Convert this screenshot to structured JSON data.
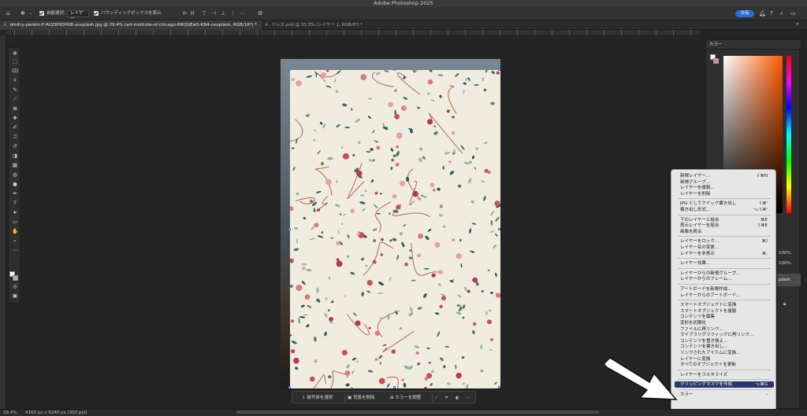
{
  "app": {
    "title": "Adobe Photoshop 2025"
  },
  "options": {
    "auto_select_label": "自動選択：",
    "layer_select": "レイヤー",
    "bounding_box_label": "バウンディングボックスを表示",
    "share": "共有"
  },
  "tabs": [
    {
      "label": "dmitry-pankin-F-AUZKHOH08-unsplash.jpg @ 29.4% (art-institute-of-chicago-6NQGEw5-KN4-unsplash, RGB/16*) *",
      "close": "×"
    },
    {
      "label": "ドレス.psd @ 33.3% (レイヤー 1, RGB/8*) *",
      "close": "×"
    }
  ],
  "status": {
    "zoom": "29.4%",
    "doc_info": "4160 px x 6240 px (300 ppi)"
  },
  "context_bar": {
    "select_subject": "被写体を選択",
    "remove_bg": "背景を削除",
    "adjust_color": "カラーを調整"
  },
  "panel": {
    "color_title": "カラー",
    "opacity": "100%",
    "fill": "100%",
    "layer_name": "plash"
  },
  "menu": {
    "items": [
      {
        "label": "新規レイヤー...",
        "shortcut": "⇧⌘N"
      },
      {
        "label": "新規グループ...",
        "shortcut": ""
      },
      {
        "label": "レイヤーを複製...",
        "shortcut": ""
      },
      {
        "label": "レイヤーを削除",
        "shortcut": ""
      },
      {
        "sep": true
      },
      {
        "label": "JPG としてクイック書き出し",
        "shortcut": "⇧⌘'"
      },
      {
        "label": "書き出し形式...",
        "shortcut": "⌥⇧⌘'"
      },
      {
        "sep": true
      },
      {
        "label": "下のレイヤーと結合",
        "shortcut": "⌘E"
      },
      {
        "label": "表示レイヤーを結合",
        "shortcut": "⇧⌘E"
      },
      {
        "label": "画像を統合",
        "shortcut": ""
      },
      {
        "sep": true
      },
      {
        "label": "レイヤーをロック...",
        "shortcut": "⌘/"
      },
      {
        "label": "レイヤー名の変更...",
        "shortcut": ""
      },
      {
        "label": "レイヤーを非表示",
        "shortcut": "⌘,"
      },
      {
        "sep": true
      },
      {
        "label": "レイヤー効果...",
        "shortcut": ""
      },
      {
        "sep": true
      },
      {
        "label": "レイヤーからの新規グループ...",
        "shortcut": ""
      },
      {
        "label": "レイヤーからのフレーム...",
        "shortcut": ""
      },
      {
        "sep": true
      },
      {
        "label": "アートボードを新規作成...",
        "shortcut": ""
      },
      {
        "label": "レイヤーからのアートボード...",
        "shortcut": ""
      },
      {
        "sep": true
      },
      {
        "label": "スマートオブジェクトに変換",
        "shortcut": ""
      },
      {
        "label": "スマートオブジェクトを複製",
        "shortcut": ""
      },
      {
        "label": "コンテンツを編集",
        "shortcut": ""
      },
      {
        "label": "変形を初期化",
        "shortcut": ""
      },
      {
        "label": "ファイルに再リンク...",
        "shortcut": ""
      },
      {
        "label": "ライブラリグラフィックに再リンク...",
        "shortcut": ""
      },
      {
        "label": "コンテンツを置き換え...",
        "shortcut": ""
      },
      {
        "label": "コンテンツを書き出し...",
        "shortcut": ""
      },
      {
        "label": "リンクされたアイテムに変換...",
        "shortcut": ""
      },
      {
        "label": "レイヤーに変換",
        "shortcut": ""
      },
      {
        "label": "すべてのオブジェクトを更新",
        "shortcut": ""
      },
      {
        "sep": true
      },
      {
        "label": "レイヤーをラスタライズ",
        "shortcut": ""
      },
      {
        "sep": true
      },
      {
        "label": "クリッピングマスクを作成",
        "shortcut": "⌥⌘G",
        "highlight": true
      },
      {
        "sep": true
      },
      {
        "label": "カラー",
        "shortcut": "›"
      }
    ]
  }
}
